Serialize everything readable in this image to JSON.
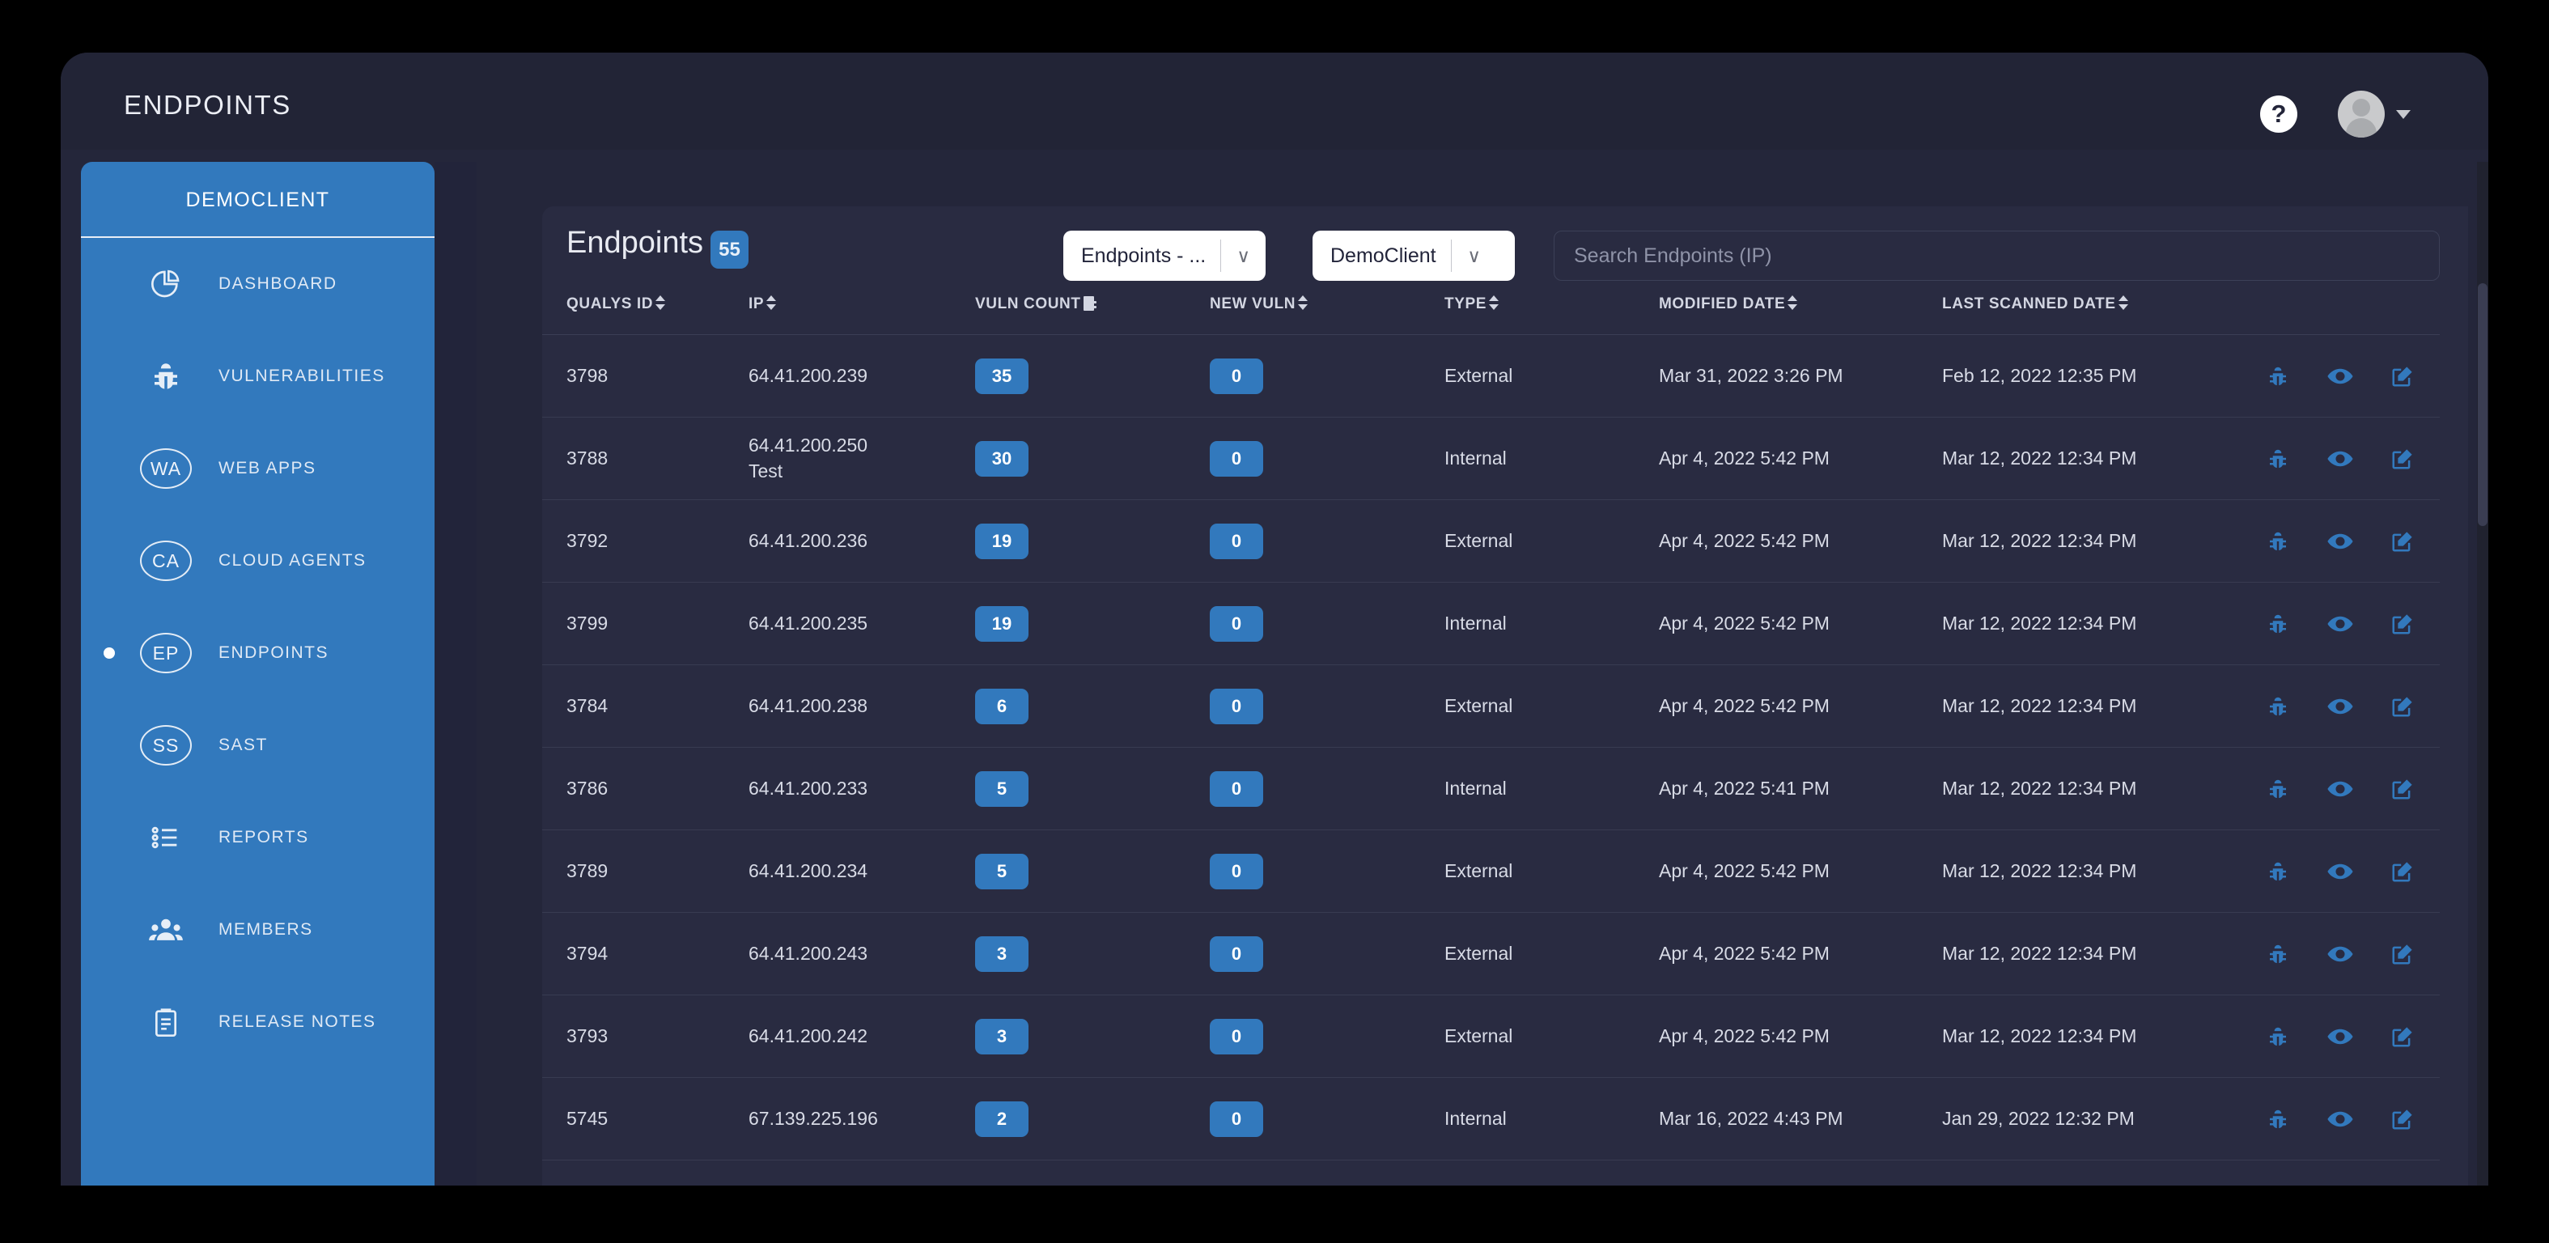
{
  "topbar": {
    "app_title": "ENDPOINTS",
    "help_label": "?",
    "help_icon": "question-mark-circle-icon",
    "avatar_icon": "user-avatar-icon",
    "caret_icon": "chevron-down-icon"
  },
  "sidebar": {
    "title": "DEMOCLIENT",
    "items": [
      {
        "label": "DASHBOARD",
        "icon": "pie-chart-icon",
        "abbr": "",
        "active": false
      },
      {
        "label": "VULNERABILITIES",
        "icon": "bug-icon",
        "abbr": "",
        "active": false
      },
      {
        "label": "WEB APPS",
        "icon": "circle-abbr-icon",
        "abbr": "WA",
        "active": false
      },
      {
        "label": "CLOUD AGENTS",
        "icon": "circle-abbr-icon",
        "abbr": "CA",
        "active": false
      },
      {
        "label": "ENDPOINTS",
        "icon": "circle-abbr-icon",
        "abbr": "EP",
        "active": true
      },
      {
        "label": "SAST",
        "icon": "circle-abbr-icon",
        "abbr": "SS",
        "active": false
      },
      {
        "label": "REPORTS",
        "icon": "list-icon",
        "abbr": "",
        "active": false
      },
      {
        "label": "MEMBERS",
        "icon": "people-icon",
        "abbr": "",
        "active": false
      },
      {
        "label": "RELEASE NOTES",
        "icon": "clipboard-icon",
        "abbr": "",
        "active": false
      }
    ]
  },
  "content": {
    "page_title": "Endpoints",
    "count_badge": "55",
    "view_select": {
      "value": "Endpoints - ...",
      "caret": "∨"
    },
    "client_select": {
      "value": "DemoClient",
      "caret": "∨"
    },
    "search": {
      "placeholder": "Search Endpoints (IP)",
      "value": ""
    }
  },
  "table": {
    "columns": [
      {
        "label": "QUALYS ID",
        "sort": "both"
      },
      {
        "label": "IP",
        "sort": "both"
      },
      {
        "label": "VULN COUNT",
        "sort": "active-desc"
      },
      {
        "label": "NEW VULN",
        "sort": "both"
      },
      {
        "label": "TYPE",
        "sort": "both"
      },
      {
        "label": "MODIFIED DATE",
        "sort": "both"
      },
      {
        "label": "LAST SCANNED DATE",
        "sort": "both"
      },
      {
        "label": "",
        "sort": "none"
      }
    ],
    "row_actions": [
      {
        "name": "bug-icon",
        "title": "Vulnerabilities"
      },
      {
        "name": "eye-icon",
        "title": "View"
      },
      {
        "name": "edit-icon",
        "title": "Edit"
      }
    ],
    "rows": [
      {
        "qualys_id": "3798",
        "ip": "64.41.200.239",
        "ip_sub": "",
        "vuln_count": "35",
        "new_vuln": "0",
        "type": "External",
        "modified_date": "Mar 31, 2022 3:26 PM",
        "last_scanned_date": "Feb 12, 2022 12:35 PM"
      },
      {
        "qualys_id": "3788",
        "ip": "64.41.200.250",
        "ip_sub": "Test",
        "vuln_count": "30",
        "new_vuln": "0",
        "type": "Internal",
        "modified_date": "Apr 4, 2022 5:42 PM",
        "last_scanned_date": "Mar 12, 2022 12:34 PM"
      },
      {
        "qualys_id": "3792",
        "ip": "64.41.200.236",
        "ip_sub": "",
        "vuln_count": "19",
        "new_vuln": "0",
        "type": "External",
        "modified_date": "Apr 4, 2022 5:42 PM",
        "last_scanned_date": "Mar 12, 2022 12:34 PM"
      },
      {
        "qualys_id": "3799",
        "ip": "64.41.200.235",
        "ip_sub": "",
        "vuln_count": "19",
        "new_vuln": "0",
        "type": "Internal",
        "modified_date": "Apr 4, 2022 5:42 PM",
        "last_scanned_date": "Mar 12, 2022 12:34 PM"
      },
      {
        "qualys_id": "3784",
        "ip": "64.41.200.238",
        "ip_sub": "",
        "vuln_count": "6",
        "new_vuln": "0",
        "type": "External",
        "modified_date": "Apr 4, 2022 5:42 PM",
        "last_scanned_date": "Mar 12, 2022 12:34 PM"
      },
      {
        "qualys_id": "3786",
        "ip": "64.41.200.233",
        "ip_sub": "",
        "vuln_count": "5",
        "new_vuln": "0",
        "type": "Internal",
        "modified_date": "Apr 4, 2022 5:41 PM",
        "last_scanned_date": "Mar 12, 2022 12:34 PM"
      },
      {
        "qualys_id": "3789",
        "ip": "64.41.200.234",
        "ip_sub": "",
        "vuln_count": "5",
        "new_vuln": "0",
        "type": "External",
        "modified_date": "Apr 4, 2022 5:42 PM",
        "last_scanned_date": "Mar 12, 2022 12:34 PM"
      },
      {
        "qualys_id": "3794",
        "ip": "64.41.200.243",
        "ip_sub": "",
        "vuln_count": "3",
        "new_vuln": "0",
        "type": "External",
        "modified_date": "Apr 4, 2022 5:42 PM",
        "last_scanned_date": "Mar 12, 2022 12:34 PM"
      },
      {
        "qualys_id": "3793",
        "ip": "64.41.200.242",
        "ip_sub": "",
        "vuln_count": "3",
        "new_vuln": "0",
        "type": "External",
        "modified_date": "Apr 4, 2022 5:42 PM",
        "last_scanned_date": "Mar 12, 2022 12:34 PM"
      },
      {
        "qualys_id": "5745",
        "ip": "67.139.225.196",
        "ip_sub": "",
        "vuln_count": "2",
        "new_vuln": "0",
        "type": "Internal",
        "modified_date": "Mar 16, 2022 4:43 PM",
        "last_scanned_date": "Jan 29, 2022 12:32 PM"
      }
    ]
  },
  "colors": {
    "brand_blue": "#3279bd",
    "panel_bg": "#292b41",
    "shell_bg": "#24263a",
    "page_bg": "#000000",
    "text_primary": "#e9ebf2"
  }
}
